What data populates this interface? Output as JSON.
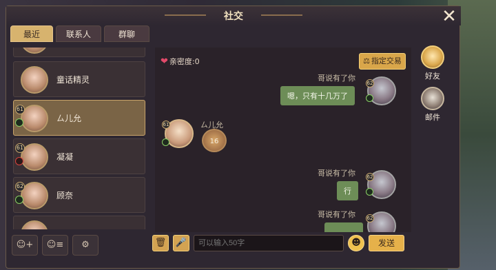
{
  "window": {
    "title": "社交"
  },
  "tabs": [
    {
      "label": "最近",
      "active": true
    },
    {
      "label": "联系人",
      "active": false
    },
    {
      "label": "群聊",
      "active": false
    }
  ],
  "recent_list": [
    {
      "name": "",
      "level": "",
      "badge_color": ""
    },
    {
      "name": "童话精灵",
      "level": "",
      "badge_color": ""
    },
    {
      "name": "ㄙ儿允",
      "level": "61",
      "badge_color": "green",
      "selected": true
    },
    {
      "name": "凝凝",
      "level": "61",
      "badge_color": "red"
    },
    {
      "name": "顾奈",
      "level": "62",
      "badge_color": "green"
    }
  ],
  "chat": {
    "intimacy_label": "亲密度:0",
    "trade_button": "指定交易",
    "messages": [
      {
        "side": "right",
        "sender": "哥说有了你",
        "text": "嗯，只有十几万了",
        "level": "62"
      },
      {
        "side": "left",
        "sender": "ㄙ儿允",
        "sticker": "16",
        "level": "61"
      },
      {
        "side": "right",
        "sender": "哥说有了你",
        "text": "行",
        "level": "62"
      },
      {
        "side": "right",
        "sender": "哥说有了你",
        "text": "",
        "level": "62"
      }
    ]
  },
  "input": {
    "placeholder": "可以输入50字",
    "send_label": "发送"
  },
  "side_nav": [
    {
      "label": "好友",
      "icon": "friend-icon"
    },
    {
      "label": "邮件",
      "icon": "mail-icon"
    }
  ],
  "colors": {
    "accent": "#d9a64a",
    "bubble": "#6d8d57",
    "panel": "#2e2731"
  }
}
